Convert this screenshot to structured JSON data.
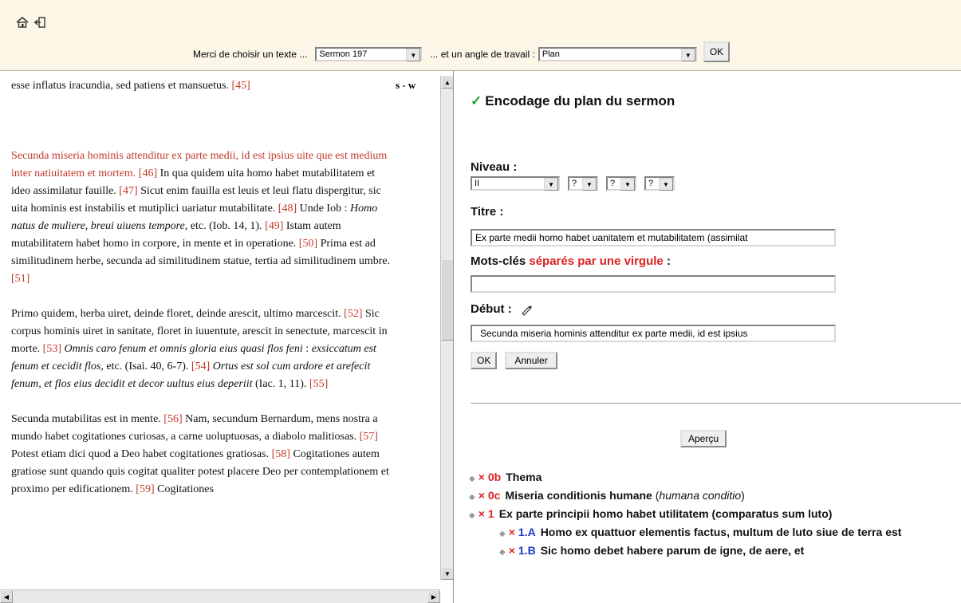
{
  "header": {
    "icons": [
      "home-icon",
      "logout-icon"
    ],
    "choose_text_label": "Merci de choisir un texte ...",
    "text_select_value": "Sermon 197",
    "angle_label": "... et un angle de travail :",
    "angle_select_value": "Plan",
    "ok_label": "OK"
  },
  "left_panel": {
    "sw_label": "s - w",
    "paragraphs": [
      {
        "pre": "esse inflatus iracundia, sed patiens et mansuetus. ",
        "refs": "[45]"
      },
      {
        "red": "Secunda miseria hominis attenditur ex parte medii, id est ipsius uite que est medium inter natiuitatem et mortem.",
        "ref1": "[46]",
        "t1": " In qua quidem uita homo habet mutabilitatem et ideo assimilatur fauille. ",
        "ref2": "[47]",
        "t2": " Sicut enim fauilla est leuis et leui flatu dispergitur, sic uita hominis est instabilis et mutiplici uariatur mutabilitate. ",
        "ref3": "[48]",
        "t3": " Unde Iob : ",
        "it1": "Homo natus de muliere, breui uiuens tempore",
        "t4": ", etc. (Iob. 14, 1). ",
        "ref4": "[49]",
        "t5": " Istam autem mutabilitatem habet homo in corpore, in mente et in operatione. ",
        "ref5": "[50]",
        "t6": " Prima est ad similitudinem herbe, secunda ad similitudinem statue, tertia ad similitudinem umbre. ",
        "ref6": "[51]"
      },
      {
        "t1": "Primo quidem, herba uiret, deinde floret, deinde arescit, ultimo marcescit. ",
        "ref1": "[52]",
        "t2": " Sic corpus hominis uiret in sanitate, floret in iuuentute, arescit in senectute, marcescit in morte. ",
        "ref2": "[53]",
        "it1": " Omnis caro fenum et omnis gloria eius quasi flos feni",
        "t3": " : ",
        "it2": "exsiccatum est fenum et cecidit flos",
        "t4": ", etc. (Isai. 40, 6-7). ",
        "ref3": "[54]",
        "it3": " Ortus est sol cum ardore et arefecit fenum, et flos eius decidit et decor uultus eius deperiit",
        "t5": " (Iac. 1, 11). ",
        "ref4": "[55]"
      },
      {
        "t1": "Secunda mutabilitas est in mente. ",
        "ref1": "[56]",
        "t2": " Nam, secundum Bernardum, mens nostra a mundo habet cogitationes curiosas, a carne uoluptuosas, a diabolo malitiosas. ",
        "ref2": "[57]",
        "t3": " Potest etiam dici quod a Deo habet cogitationes gratiosas. ",
        "ref3": "[58]",
        "t4": " Cogitationes autem gratiose sunt quando quis cogitat qualiter potest placere Deo per contemplationem et proximo per edificationem. ",
        "ref4": "[59]",
        "t5": " Cogitationes"
      }
    ]
  },
  "form": {
    "title": "Encodage du plan du sermon",
    "niveau_label": "Niveau :",
    "niveau_value": "II",
    "q_values": [
      "?",
      "?",
      "?"
    ],
    "titre_label": "Titre :",
    "titre_value": "Ex parte medii homo habet uanitatem et mutabilitatem (assimilat",
    "mots_label": "Mots-clés",
    "mots_label_red": "séparés par une virgule",
    "mots_label_end": ":",
    "mots_value": "",
    "debut_label": "Début :",
    "debut_value": "Secunda miseria hominis attenditur ex parte medii, id est ipsius",
    "ok_label": "OK",
    "annuler_label": "Annuler",
    "apercu_label": "Aperçu"
  },
  "tree": [
    {
      "num": "0b",
      "text": "Thema"
    },
    {
      "num": "0c",
      "text": "Miseria conditionis humane",
      "extra": "humana conditio"
    },
    {
      "num": "1",
      "text": "Ex parte principii homo habet utilitatem (comparatus sum luto)"
    },
    {
      "num": "1.A",
      "text": "Homo ex quattuor elementis factus, multum de luto siue de terra est"
    },
    {
      "num": "1.B",
      "text": "Sic homo debet habere parum de igne, de aere, et"
    }
  ]
}
